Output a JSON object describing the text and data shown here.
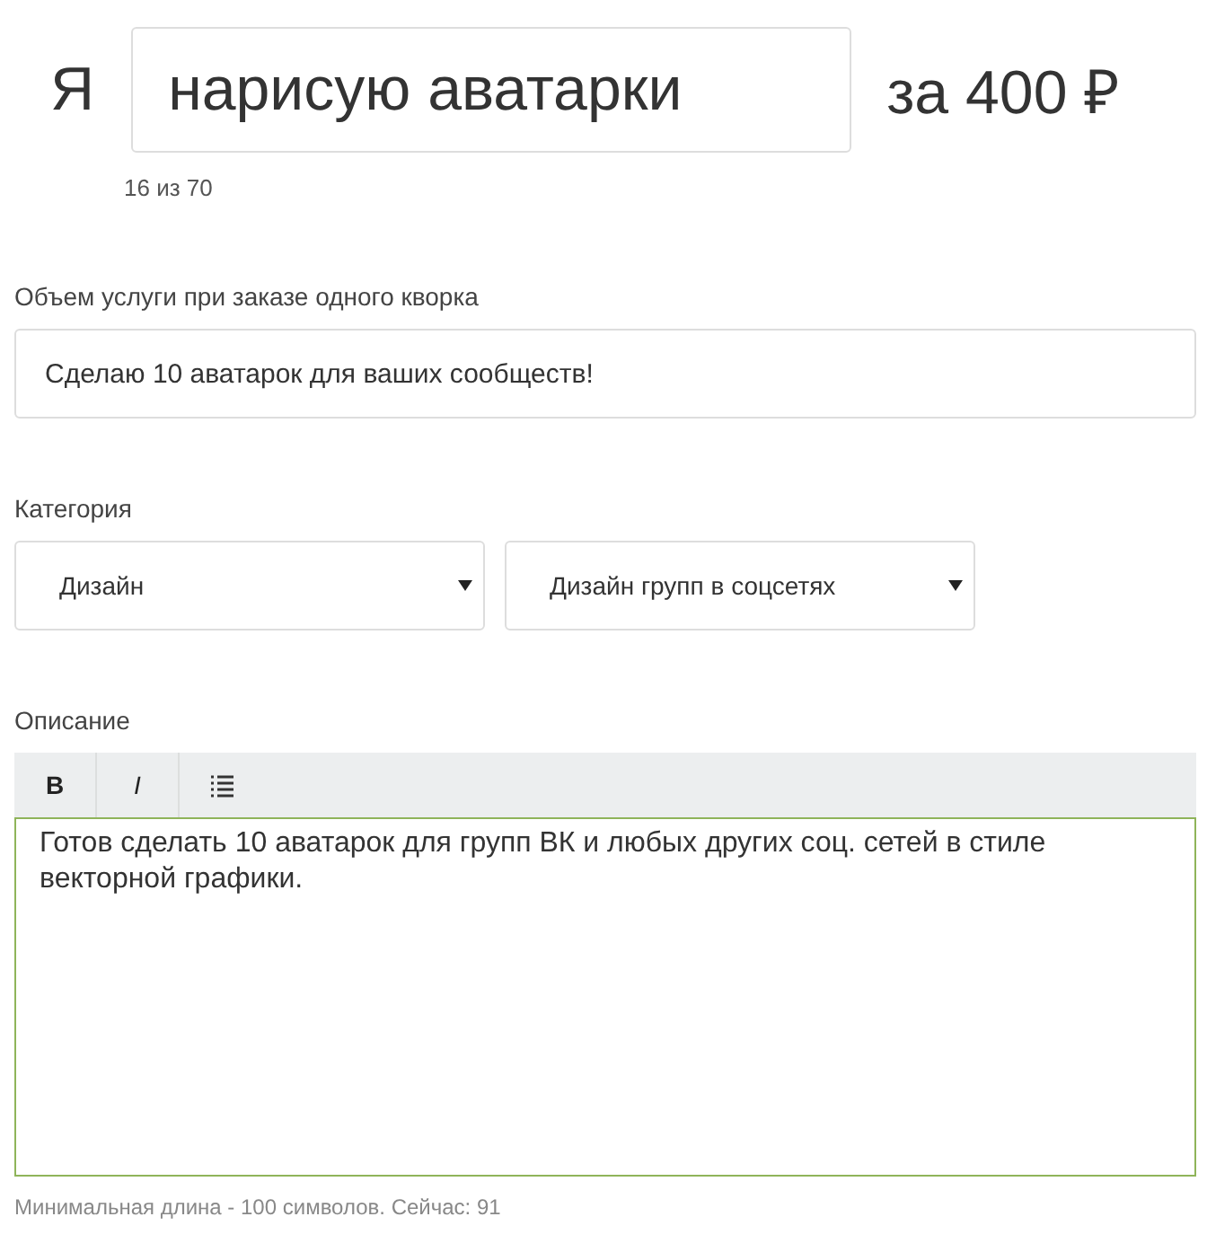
{
  "title": {
    "prefix": "Я",
    "value": "нарисую аватарки",
    "suffix": "за 400 ₽",
    "counter": "16 из 70"
  },
  "volume": {
    "label": "Объем услуги при заказе одного кворка",
    "value": "Сделаю 10 аватарок для ваших сообществ!"
  },
  "category": {
    "label": "Категория",
    "selects": [
      {
        "value": "Дизайн"
      },
      {
        "value": "Дизайн групп в соцсетях"
      }
    ]
  },
  "description": {
    "label": "Описание",
    "toolbar": [
      {
        "kind": "bold",
        "label": "B"
      },
      {
        "kind": "italic",
        "label": "I"
      },
      {
        "kind": "list"
      }
    ],
    "value": "Готов сделать 10 аватарок для групп ВК и любых других соц. сетей в стиле векторной графики.",
    "hint": "Минимальная длина - 100 символов. Сейчас: 91"
  }
}
